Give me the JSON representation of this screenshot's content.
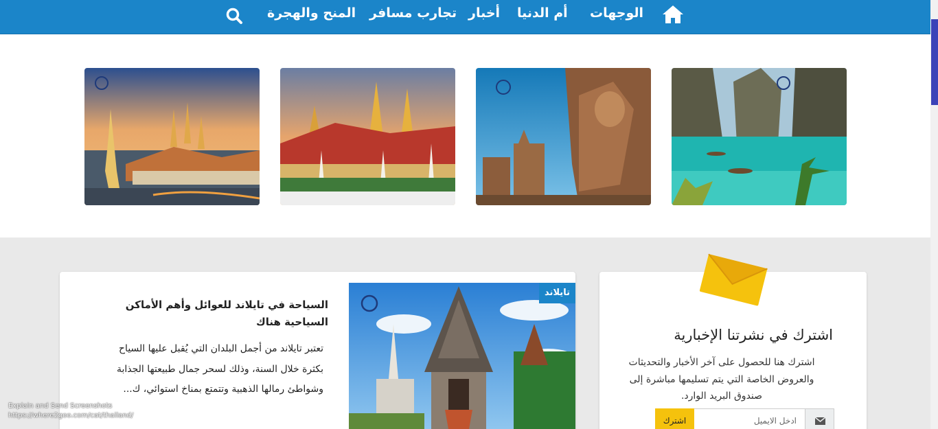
{
  "nav": {
    "items": [
      {
        "label": "الوجهات"
      },
      {
        "label": "أم الدنيا"
      },
      {
        "label": "أخبار"
      },
      {
        "label": "تجارب مسافر"
      },
      {
        "label": "المنح والهجرة"
      }
    ],
    "home_icon": "home-icon",
    "search_icon": "search-icon"
  },
  "gallery": {
    "images": [
      {
        "icon": "bangkok-temple-photo"
      },
      {
        "icon": "grand-palace-photo"
      },
      {
        "icon": "buddha-statue-photo"
      },
      {
        "icon": "phi-phi-islands-photo"
      }
    ]
  },
  "article": {
    "category": "تايلاند",
    "title": "السياحة في تايلاند للعوائل وأهم الأماكن السياحية هناك",
    "excerpt": "تعتبر تايلاند من أجمل البلدان التي يُقبل عليها السياح بكثرة خلال السنة، وذلك لسحر جمال طبيعتها الجذابة وشواطئ رمالها الذهبية وتتمتع بمناخ استوائي، ك..."
  },
  "newsletter": {
    "title": "اشترك في نشرتنا الإخبارية",
    "description": "اشترك هنا للحصول على آخر الأخبار والتحديثات والعروض الخاصة التي يتم تسليمها مباشرة إلى صندوق البريد الوارد.",
    "email_placeholder": "ادخل الايميل",
    "subscribe_label": "اشترك"
  },
  "overlay": {
    "line1": "Explain and Send Screenshots",
    "line2": "https://where2goo.com/cat/thailand/"
  },
  "colors": {
    "nav_blue": "#1b85c9",
    "accent_yellow": "#f5c20d",
    "section_grey": "#e9e9e9"
  }
}
